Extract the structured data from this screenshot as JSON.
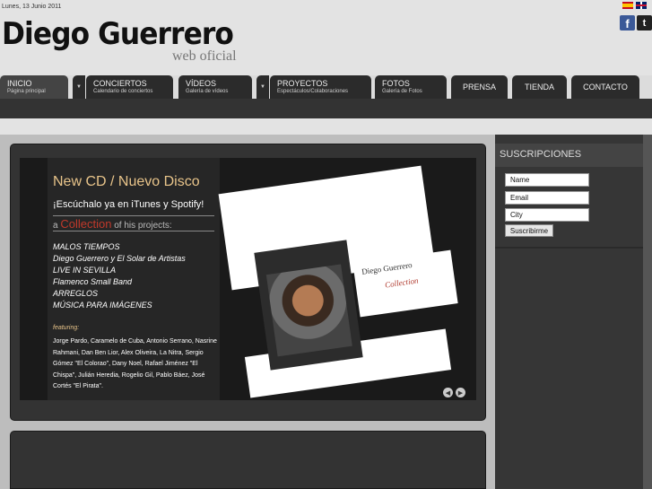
{
  "header": {
    "date": "Lunes, 13 Junio 2011",
    "logo": "Diego Guerrero",
    "subtitle": "web oficial",
    "flags": [
      "flag-es-icon",
      "flag-uk-icon"
    ],
    "social": {
      "fb": "f",
      "tw": "t"
    }
  },
  "nav": {
    "items": [
      {
        "title": "INICIO",
        "sub": "Página principal"
      },
      {
        "title": "CONCIERTOS",
        "sub": "Calendario de conciertos"
      },
      {
        "title": "VÍDEOS",
        "sub": "Galería de vídeos"
      },
      {
        "title": "PROYECTOS",
        "sub": "Espectáculos/Colaboraciones"
      },
      {
        "title": "FOTOS",
        "sub": "Galería de Fotos"
      },
      {
        "title": "PRENSA"
      },
      {
        "title": "TIENDA"
      },
      {
        "title": "CONTACTO"
      }
    ],
    "dropdown_glyph": "▼"
  },
  "promo": {
    "title": "New CD / Nuevo Disco",
    "subtitle": "¡Escúchalo ya en iTunes y Spotify!",
    "collection_prefix": "a",
    "collection_word": "Collection",
    "collection_suffix": "of his projects:",
    "projects": [
      "MALOS TIEMPOS",
      "Diego Guerrero y El Solar de Artistas",
      "LIVE IN SEVILLA",
      "Flamenco Small Band",
      "ARREGLOS",
      "MÚSICA PARA IMÁGENES"
    ],
    "featuring_label": "featuring:",
    "featuring": "Jorge Pardo, Caramelo de Cuba, Antonio Serrano, Nasrine Rahmani, Dan Ben Lior, Alex Oliveira, La Nitra, Sergio Gómez \"El Colorao\", Dany Noel, Rafael Jiménez \"El Chispa\", Julián Heredia, Rogelio Gil, Pablo Báez, José Cortés \"El Pirata\".",
    "album_artist": "Diego Guerrero",
    "album_title": "Collection",
    "prev": "◀",
    "next": "▶"
  },
  "sidebar": {
    "title": "SUSCRIPCIONES",
    "name_value": "Name",
    "email_value": "Email",
    "city_value": "City",
    "submit": "Suscribirme"
  },
  "colors": {
    "accent": "#e8c48a",
    "highlight": "#c0392b",
    "nav": "#2b2b2b",
    "panel": "#333333"
  }
}
